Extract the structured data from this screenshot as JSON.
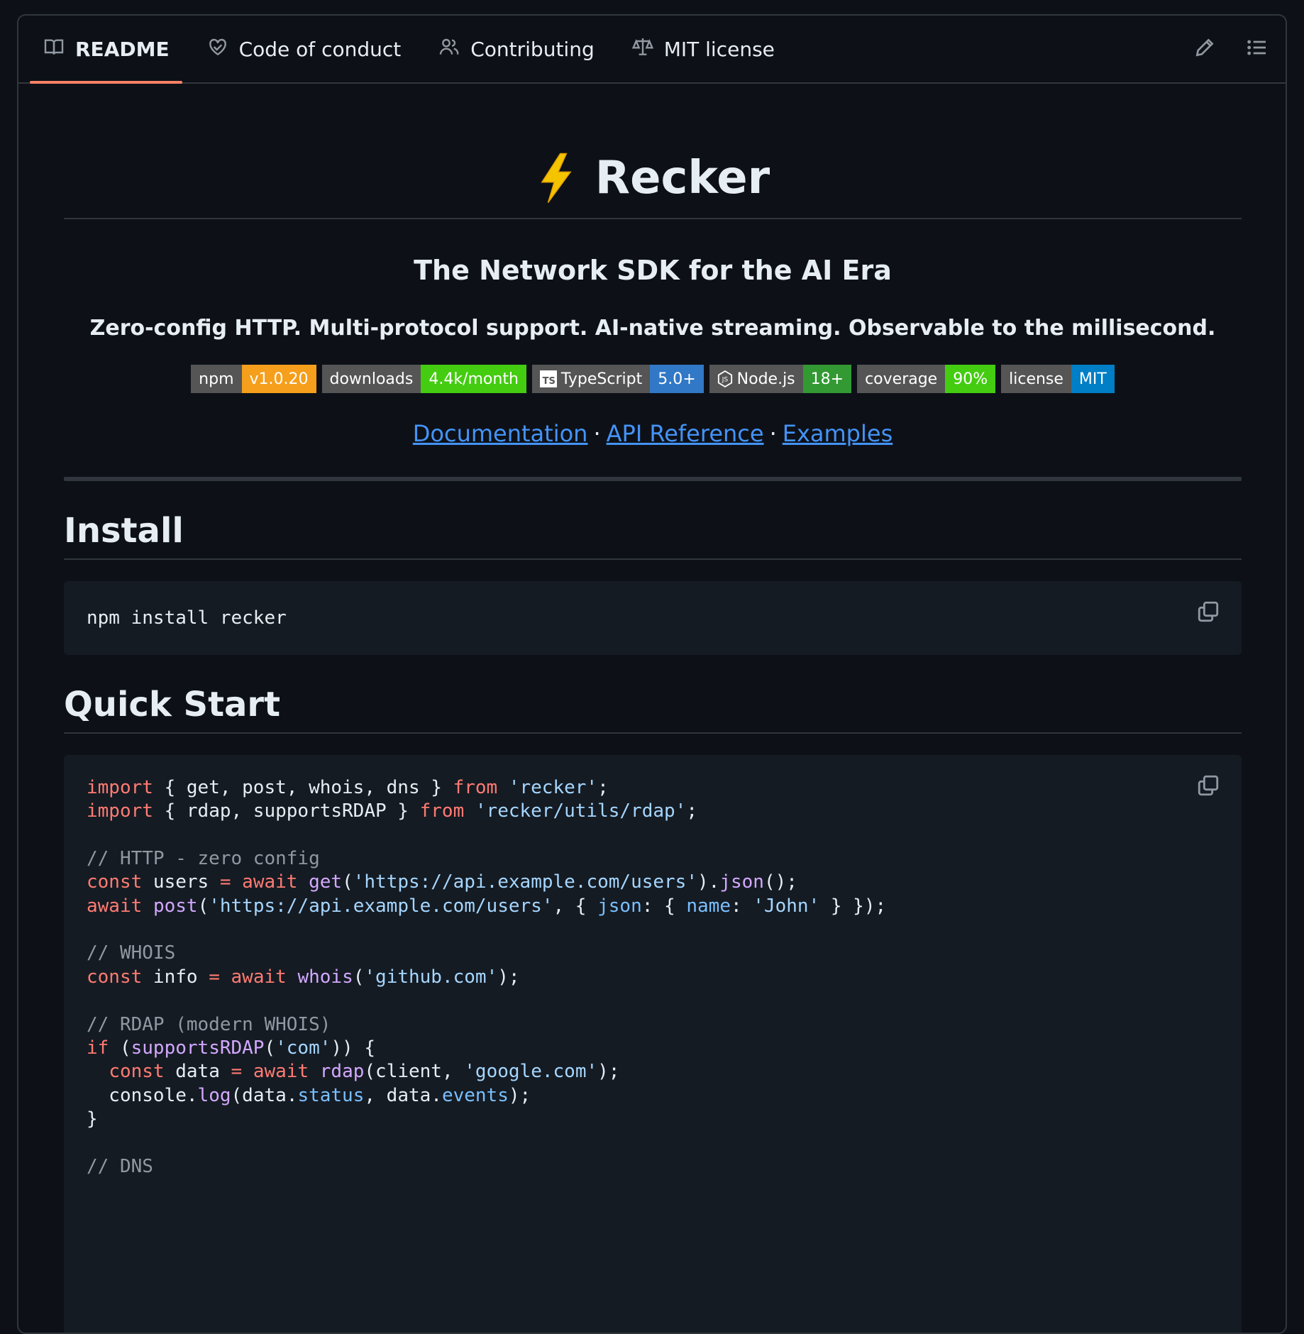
{
  "tabs": [
    {
      "label": "README",
      "icon": "book-icon",
      "active": true
    },
    {
      "label": "Code of conduct",
      "icon": "code-of-conduct-icon",
      "active": false
    },
    {
      "label": "Contributing",
      "icon": "people-icon",
      "active": false
    },
    {
      "label": "MIT license",
      "icon": "law-icon",
      "active": false
    }
  ],
  "actions": {
    "edit_icon": "pencil-icon",
    "outline_icon": "list-unordered-icon"
  },
  "readme": {
    "title": "Recker",
    "title_emoji": "⚡",
    "subtitle": "The Network SDK for the AI Era",
    "tagline": "Zero-config HTTP. Multi-protocol support. AI-native streaming. Observable to the millisecond.",
    "badges": [
      {
        "label": "npm",
        "value": "v1.0.20",
        "color": "#f59f1c"
      },
      {
        "label": "downloads",
        "value": "4.4k/month",
        "color": "#4c1"
      },
      {
        "label": "TypeScript",
        "value": "5.0+",
        "color": "#3178c6",
        "logo": "TS"
      },
      {
        "label": "Node.js",
        "value": "18+",
        "color": "#339933",
        "logo": "node-icon"
      },
      {
        "label": "coverage",
        "value": "90%",
        "color": "#44cc11"
      },
      {
        "label": "license",
        "value": "MIT",
        "color": "#007ec6"
      }
    ],
    "links": [
      {
        "label": "Documentation"
      },
      {
        "label": "API Reference"
      },
      {
        "label": "Examples"
      }
    ],
    "link_separator": "·",
    "install": {
      "heading": "Install",
      "code": "npm install recker"
    },
    "quick_start": {
      "heading": "Quick Start",
      "code_lines": [
        [
          [
            "kw",
            "import"
          ],
          [
            "t",
            " { get, post, whois, dns } "
          ],
          [
            "kw",
            "from"
          ],
          [
            "t",
            " "
          ],
          [
            "str",
            "'recker'"
          ],
          [
            "t",
            ";"
          ]
        ],
        [
          [
            "kw",
            "import"
          ],
          [
            "t",
            " { rdap, supportsRDAP } "
          ],
          [
            "kw",
            "from"
          ],
          [
            "t",
            " "
          ],
          [
            "str",
            "'recker/utils/rdap'"
          ],
          [
            "t",
            ";"
          ]
        ],
        [],
        [
          [
            "cm",
            "// HTTP - zero config"
          ]
        ],
        [
          [
            "kw",
            "const"
          ],
          [
            "t",
            " users "
          ],
          [
            "kw",
            "="
          ],
          [
            "t",
            " "
          ],
          [
            "kw",
            "await"
          ],
          [
            "t",
            " "
          ],
          [
            "fn",
            "get"
          ],
          [
            "t",
            "("
          ],
          [
            "str",
            "'https://api.example.com/users'"
          ],
          [
            "t",
            ")."
          ],
          [
            "fn",
            "json"
          ],
          [
            "t",
            "();"
          ]
        ],
        [
          [
            "kw",
            "await"
          ],
          [
            "t",
            " "
          ],
          [
            "fn",
            "post"
          ],
          [
            "t",
            "("
          ],
          [
            "str",
            "'https://api.example.com/users'"
          ],
          [
            "t",
            ", { "
          ],
          [
            "prop",
            "json"
          ],
          [
            "t",
            ": { "
          ],
          [
            "prop",
            "name"
          ],
          [
            "t",
            ": "
          ],
          [
            "str",
            "'John'"
          ],
          [
            "t",
            " } });"
          ]
        ],
        [],
        [
          [
            "cm",
            "// WHOIS"
          ]
        ],
        [
          [
            "kw",
            "const"
          ],
          [
            "t",
            " info "
          ],
          [
            "kw",
            "="
          ],
          [
            "t",
            " "
          ],
          [
            "kw",
            "await"
          ],
          [
            "t",
            " "
          ],
          [
            "fn",
            "whois"
          ],
          [
            "t",
            "("
          ],
          [
            "str",
            "'github.com'"
          ],
          [
            "t",
            ");"
          ]
        ],
        [],
        [
          [
            "cm",
            "// RDAP (modern WHOIS)"
          ]
        ],
        [
          [
            "kw",
            "if"
          ],
          [
            "t",
            " ("
          ],
          [
            "fn",
            "supportsRDAP"
          ],
          [
            "t",
            "("
          ],
          [
            "str",
            "'com'"
          ],
          [
            "t",
            ")) {"
          ]
        ],
        [
          [
            "t",
            "  "
          ],
          [
            "kw",
            "const"
          ],
          [
            "t",
            " data "
          ],
          [
            "kw",
            "="
          ],
          [
            "t",
            " "
          ],
          [
            "kw",
            "await"
          ],
          [
            "t",
            " "
          ],
          [
            "fn",
            "rdap"
          ],
          [
            "t",
            "(client, "
          ],
          [
            "str",
            "'google.com'"
          ],
          [
            "t",
            ");"
          ]
        ],
        [
          [
            "t",
            "  console."
          ],
          [
            "fn",
            "log"
          ],
          [
            "t",
            "(data."
          ],
          [
            "prop",
            "status"
          ],
          [
            "t",
            ", data."
          ],
          [
            "prop",
            "events"
          ],
          [
            "t",
            ");"
          ]
        ],
        [
          [
            "t",
            "}"
          ]
        ],
        [],
        [
          [
            "cm",
            "// DNS"
          ]
        ]
      ]
    }
  }
}
